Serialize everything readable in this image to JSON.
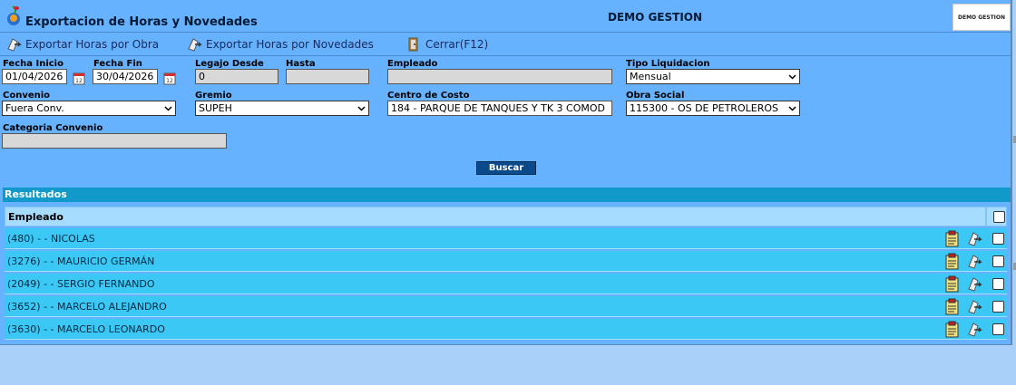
{
  "window": {
    "title": "Exportacion de Horas y Novedades",
    "company": "DEMO GESTION",
    "company_logo_text": "DEMO GESTION"
  },
  "toolbar": {
    "export_obra": "Exportar Horas por Obra",
    "export_novedades": "Exportar Horas por Novedades",
    "close": "Cerrar(F12)"
  },
  "filters": {
    "fecha_inicio": {
      "label": "Fecha Inicio",
      "value": "01/04/2026"
    },
    "fecha_fin": {
      "label": "Fecha Fin",
      "value": "30/04/2026"
    },
    "legajo_desde": {
      "label": "Legajo Desde",
      "value": "0"
    },
    "hasta": {
      "label": "Hasta",
      "value": ""
    },
    "empleado": {
      "label": "Empleado",
      "value": ""
    },
    "tipo_liquidacion": {
      "label": "Tipo Liquidacion",
      "value": "Mensual"
    },
    "convenio": {
      "label": "Convenio",
      "value": "Fuera Conv."
    },
    "gremio": {
      "label": "Gremio",
      "value": "SUPEH"
    },
    "centro_costo": {
      "label": "Centro de Costo",
      "value": "184 - PARQUE DE TANQUES Y TK 3 COMOD"
    },
    "obra_social": {
      "label": "Obra Social",
      "value": "115300 - OS DE PETROLEROS"
    },
    "categoria_convenio": {
      "label": "Categoria Convenio",
      "value": ""
    },
    "buscar_label": "Buscar"
  },
  "results": {
    "title": "Resultados",
    "column_header": "Empleado",
    "rows": [
      {
        "name": "(480) - - NICOLAS"
      },
      {
        "name": "(3276) - - MAURICIO GERMÁN"
      },
      {
        "name": "(2049) - - SERGIO FERNANDO"
      },
      {
        "name": "(3652) - - MARCELO ALEJANDRO"
      },
      {
        "name": "(3630) - - MARCELO LEONARDO"
      }
    ]
  },
  "colors": {
    "background": "#66b2ff",
    "results_header": "#1099c9",
    "row": "#3cc8f5",
    "button": "#0a4a8a"
  }
}
